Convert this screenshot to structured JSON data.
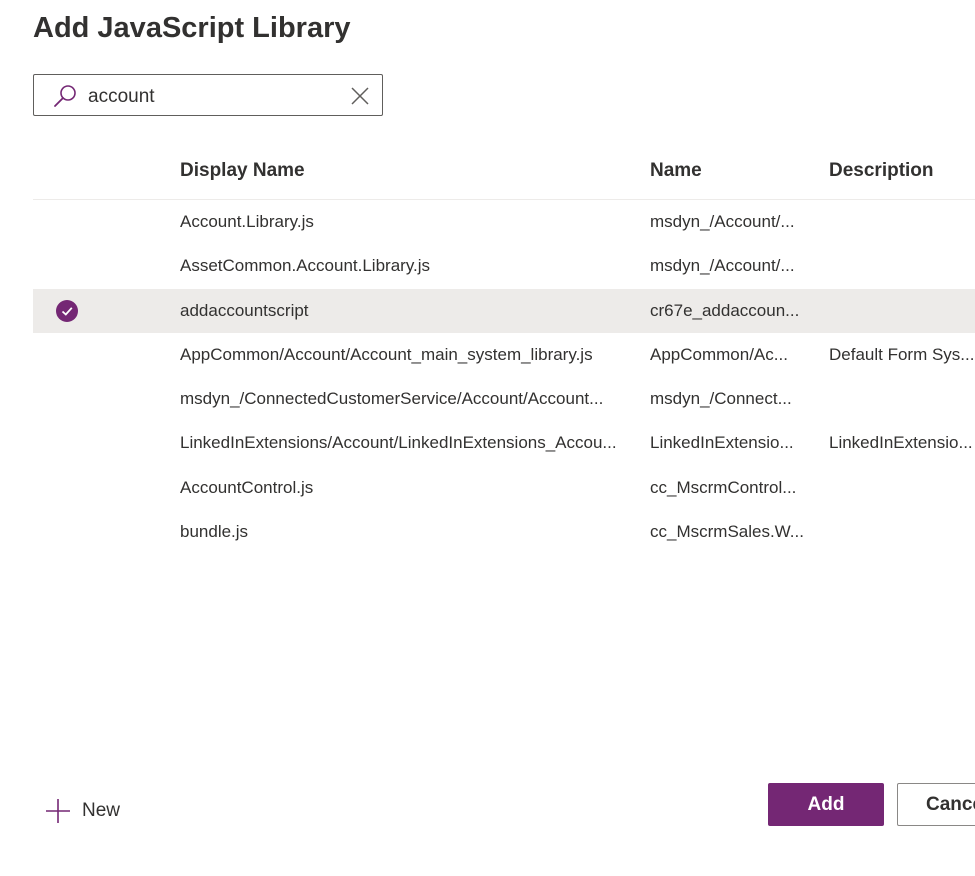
{
  "dialog": {
    "title": "Add JavaScript Library"
  },
  "search": {
    "value": "account",
    "search_icon": "search-icon",
    "clear_icon": "close-icon"
  },
  "grid": {
    "columns": [
      "Display Name",
      "Name",
      "Description"
    ],
    "rows": [
      {
        "display_name": "Account.Library.js",
        "name": "msdyn_/Account/...",
        "description": "",
        "selected": false
      },
      {
        "display_name": "AssetCommon.Account.Library.js",
        "name": "msdyn_/Account/...",
        "description": "",
        "selected": false
      },
      {
        "display_name": "addaccountscript",
        "name": "cr67e_addaccoun...",
        "description": "",
        "selected": true
      },
      {
        "display_name": "AppCommon/Account/Account_main_system_library.js",
        "name": "AppCommon/Ac...",
        "description": "Default Form Sys...",
        "selected": false
      },
      {
        "display_name": "msdyn_/ConnectedCustomerService/Account/Account...",
        "name": "msdyn_/Connect...",
        "description": "",
        "selected": false
      },
      {
        "display_name": "LinkedInExtensions/Account/LinkedInExtensions_Accou...",
        "name": "LinkedInExtensio...",
        "description": "LinkedInExtensio...",
        "selected": false
      },
      {
        "display_name": "AccountControl.js",
        "name": "cc_MscrmControl...",
        "description": "",
        "selected": false
      },
      {
        "display_name": "bundle.js",
        "name": "cc_MscrmSales.W...",
        "description": "",
        "selected": false
      }
    ]
  },
  "footer": {
    "new_label": "New",
    "new_icon": "plus-icon",
    "add_label": "Add",
    "cancel_label": "Cancel"
  },
  "colors": {
    "accent": "#742774",
    "selected_row": "#edebe9",
    "text": "#323130"
  }
}
